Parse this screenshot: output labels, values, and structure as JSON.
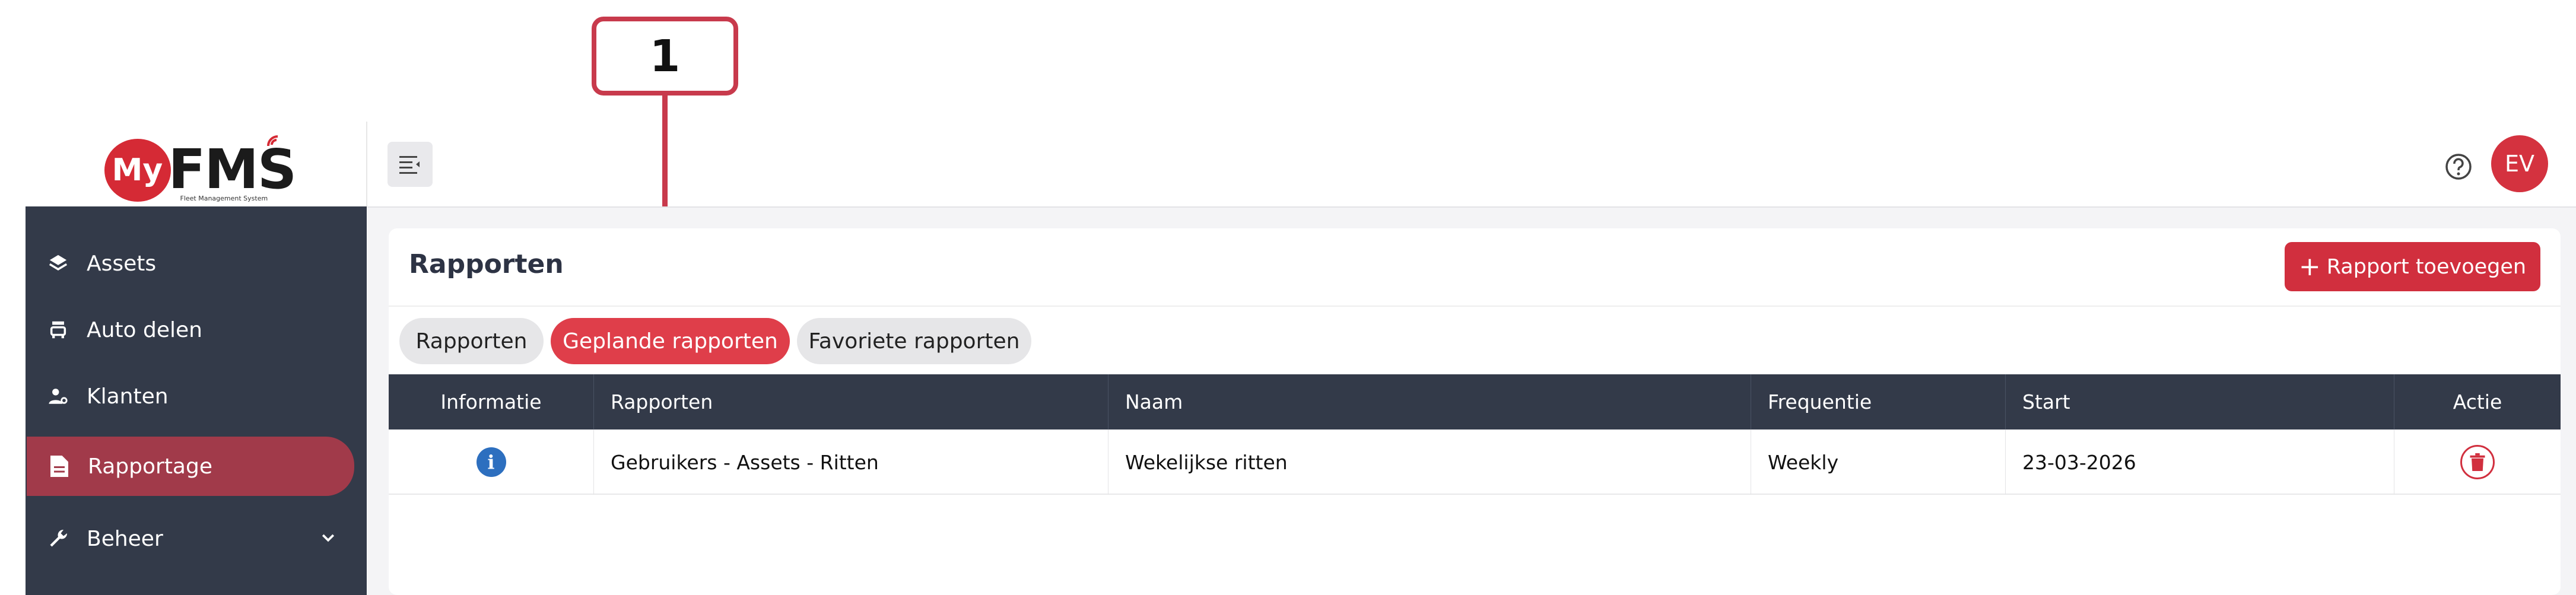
{
  "annotation": {
    "step_number": "1"
  },
  "brand": {
    "logo_prefix": "My",
    "logo_main": "FMS",
    "logo_tagline": "Fleet Management System"
  },
  "sidebar": {
    "items": [
      {
        "label": "Assets",
        "icon": "layers-icon"
      },
      {
        "label": "Auto delen",
        "icon": "car-share-icon"
      },
      {
        "label": "Klanten",
        "icon": "user-settings-icon"
      },
      {
        "label": "Rapportage",
        "icon": "document-icon",
        "active": true
      },
      {
        "label": "Beheer",
        "icon": "wrench-icon",
        "expandable": true
      }
    ]
  },
  "topbar": {
    "avatar_initials": "EV"
  },
  "page": {
    "title": "Rapporten",
    "add_button": "Rapport toevoegen",
    "tabs": [
      {
        "label": "Rapporten",
        "active": false
      },
      {
        "label": "Geplande rapporten",
        "active": true
      },
      {
        "label": "Favoriete rapporten",
        "active": false
      }
    ]
  },
  "table": {
    "headers": [
      "Informatie",
      "Rapporten",
      "Naam",
      "Frequentie",
      "Start",
      "Actie"
    ],
    "rows": [
      {
        "rapporten": "Gebruikers - Assets - Ritten",
        "naam": "Wekelijkse ritten",
        "frequentie": "Weekly",
        "start": "23-03-2026"
      }
    ]
  },
  "colors": {
    "accent": "#d12f3e",
    "sidebar": "#333a49",
    "active_nav": "#a13a4a",
    "info": "#2d6fbf"
  }
}
